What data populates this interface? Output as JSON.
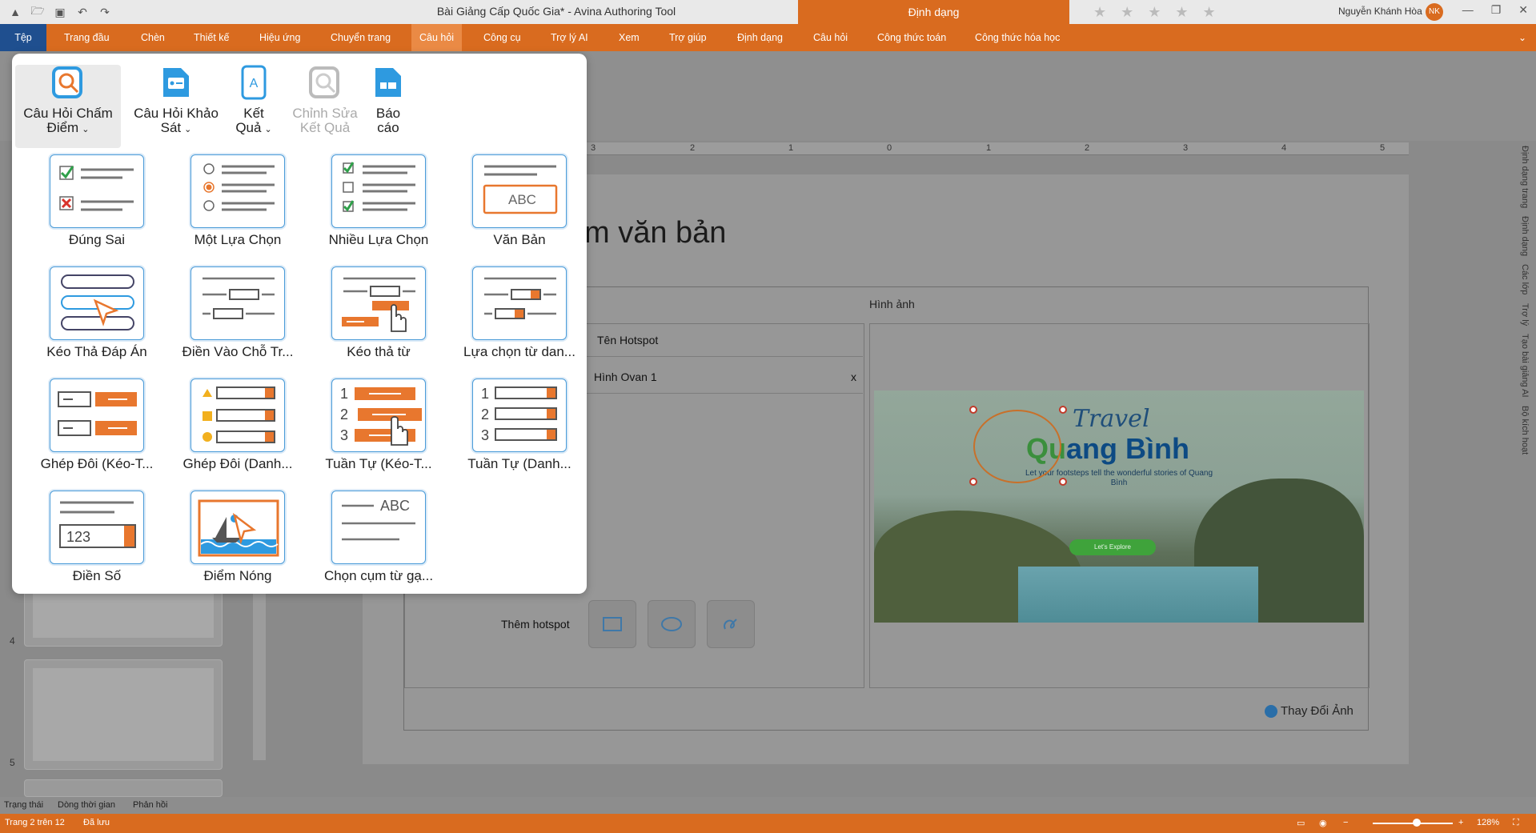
{
  "window": {
    "title": "Bài Giảng Cấp Quốc Gia* - Avina Authoring Tool",
    "context_tab": "Định dạng",
    "user_name": "Nguyễn Khánh Hòa",
    "user_initials": "NK"
  },
  "menu": {
    "items": [
      "Tệp",
      "Trang đầu",
      "Chèn",
      "Thiết kế",
      "Hiệu ứng",
      "Chuyển trang",
      "Câu hỏi",
      "Công cụ",
      "Trợ lý AI",
      "Xem",
      "Trợ giúp",
      "Định dạng",
      "Câu hỏi",
      "Công thức toán",
      "Công thức hóa học"
    ],
    "active": "Câu hỏi"
  },
  "gallery": {
    "top_buttons": [
      {
        "label": "Câu Hỏi Chấm Điểm",
        "icon": "graded-question-icon",
        "has_dropdown": true,
        "selected": true
      },
      {
        "label": "Câu Hỏi Khảo Sát",
        "icon": "survey-question-icon",
        "has_dropdown": true
      },
      {
        "label": "Kết Quả",
        "icon": "result-icon",
        "has_dropdown": true
      },
      {
        "label": "Chỉnh Sửa Kết Quả",
        "icon": "edit-result-icon",
        "disabled": true
      },
      {
        "label": "Báo cáo",
        "icon": "report-icon"
      }
    ],
    "items": [
      {
        "label": "Đúng Sai",
        "icon": "true-false-icon"
      },
      {
        "label": "Một Lựa Chọn",
        "icon": "single-choice-icon"
      },
      {
        "label": "Nhiều Lựa Chọn",
        "icon": "multiple-choice-icon"
      },
      {
        "label": "Văn Bản",
        "icon": "text-answer-icon"
      },
      {
        "label": "Kéo Thả Đáp Án",
        "icon": "drag-drop-answer-icon"
      },
      {
        "label": "Điền Vào Chỗ Tr...",
        "icon": "fill-blank-icon"
      },
      {
        "label": "Kéo thả từ",
        "icon": "drag-word-icon"
      },
      {
        "label": "Lựa chọn từ dan...",
        "icon": "select-from-list-icon"
      },
      {
        "label": "Ghép Đôi (Kéo-T...",
        "icon": "matching-drag-icon"
      },
      {
        "label": "Ghép Đôi (Danh...",
        "icon": "matching-list-icon"
      },
      {
        "label": "Tuần Tự (Kéo-T...",
        "icon": "sequence-drag-icon"
      },
      {
        "label": "Tuần Tự (Danh...",
        "icon": "sequence-list-icon"
      },
      {
        "label": "Điền Số",
        "icon": "numeric-icon"
      },
      {
        "label": "Điểm Nóng",
        "icon": "hotspot-icon"
      },
      {
        "label": "Chọn cụm từ gạ...",
        "icon": "select-phrase-icon"
      }
    ]
  },
  "editor": {
    "slide_title_fragment": "m văn bản",
    "image_header": "Hình ảnh",
    "hotspot_name_header": "Tên Hotspot",
    "hotspot_row": "Hình Ovan 1",
    "remove_label": "x",
    "add_hotspot_label": "Thêm hotspot",
    "change_image_label": "Thay Đổi Ảnh",
    "ruler_numbers": [
      "3",
      "2",
      "1",
      "0",
      "1",
      "2",
      "3",
      "4",
      "5"
    ],
    "image_text": {
      "travel": "Travel",
      "brand_q": "Qu",
      "brand_rest": "ang Bình",
      "tagline": "Let your footsteps tell the wonderful stories of Quang Bình",
      "cta": "Let's Explore"
    }
  },
  "thumbnails": {
    "numbers": [
      "4",
      "5"
    ]
  },
  "side_panel": [
    "Định dạng trang",
    "Định dạng",
    "Các lớp",
    "Trợ lý",
    "Tạo bài giảng AI",
    "Bộ kích hoạt"
  ],
  "bottom_tabs": [
    "Trạng thái",
    "Dòng thời gian",
    "Phản hồi"
  ],
  "status": {
    "page": "Trang 2 trên 12",
    "saved": "Đã lưu",
    "zoom": "128%"
  },
  "colors": {
    "accent": "#d96b1f",
    "file_tab": "#1f4f8f",
    "card_border": "#4a9bd8",
    "card_orange": "#e8772e"
  }
}
